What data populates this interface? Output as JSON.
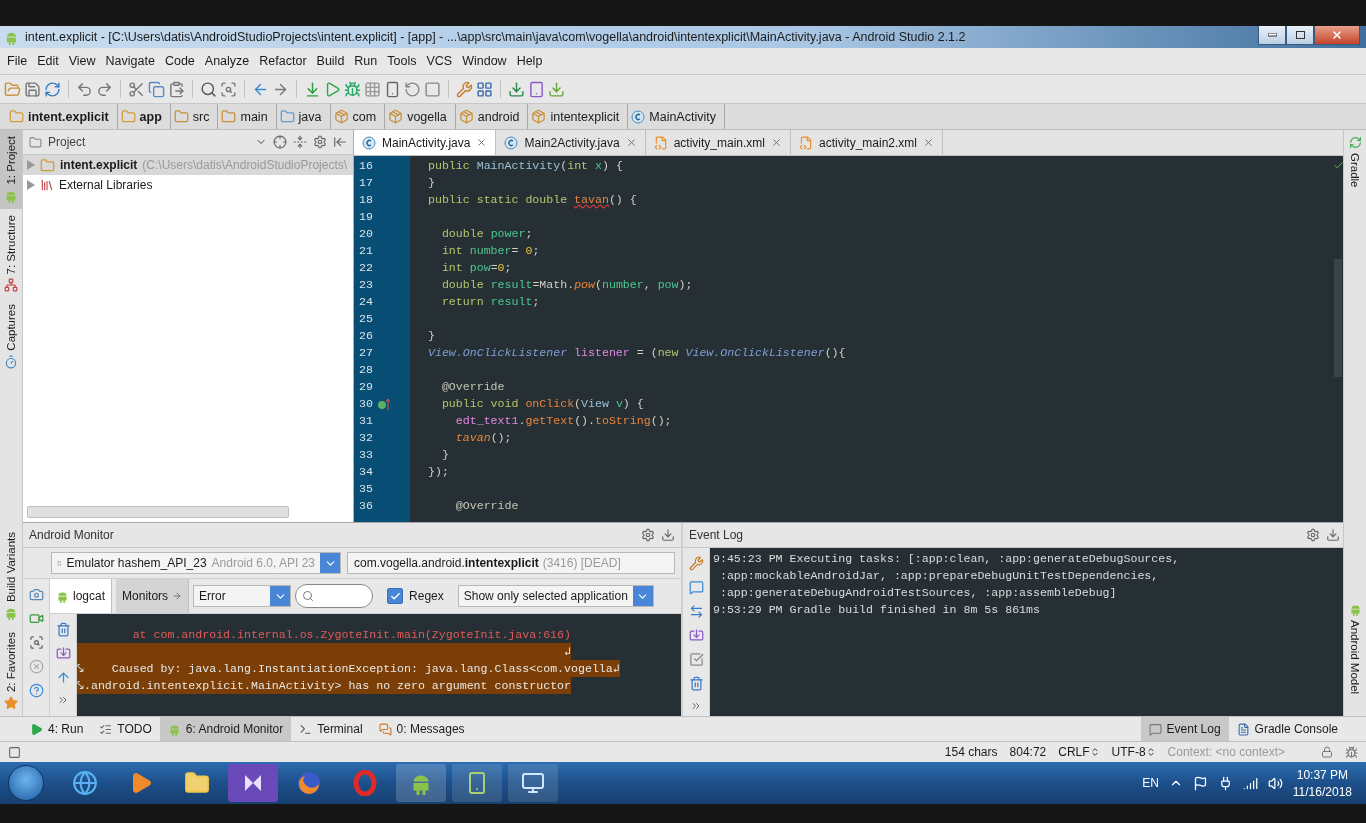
{
  "window": {
    "title": "intent.explicit - [C:\\Users\\datis\\AndroidStudioProjects\\intent.explicit] - [app] - ...\\app\\src\\main\\java\\com\\vogella\\android\\intentexplicit\\MainActivity.java - Android Studio 2.1.2"
  },
  "menu": [
    "File",
    "Edit",
    "View",
    "Navigate",
    "Code",
    "Analyze",
    "Refactor",
    "Build",
    "Run",
    "Tools",
    "VCS",
    "Window",
    "Help"
  ],
  "breadcrumbs": [
    {
      "label": "intent.explicit",
      "kind": "module"
    },
    {
      "label": "app",
      "kind": "module"
    },
    {
      "label": "src",
      "kind": "folder"
    },
    {
      "label": "main",
      "kind": "folder"
    },
    {
      "label": "java",
      "kind": "source"
    },
    {
      "label": "com",
      "kind": "package"
    },
    {
      "label": "vogella",
      "kind": "package"
    },
    {
      "label": "android",
      "kind": "package"
    },
    {
      "label": "intentexplicit",
      "kind": "package"
    },
    {
      "label": "MainActivity",
      "kind": "class"
    }
  ],
  "left_stripe": {
    "top": [
      {
        "label": "1: Project",
        "selected": true
      },
      {
        "label": "7: Structure",
        "selected": false
      },
      {
        "label": "Captures",
        "selected": false
      }
    ],
    "bottom": [
      {
        "label": "Build Variants",
        "selected": false
      },
      {
        "label": "2: Favorites",
        "selected": false
      }
    ]
  },
  "right_stripe": {
    "top": [
      "Gradle"
    ],
    "bottom": [
      "Android Model"
    ]
  },
  "project": {
    "view": "Project",
    "tree": [
      {
        "label": "intent.explicit",
        "detail": "(C:\\Users\\datis\\AndroidStudioProjects\\",
        "kind": "module",
        "selected": true
      },
      {
        "label": "External Libraries",
        "kind": "library",
        "selected": false
      }
    ]
  },
  "editor": {
    "tabs": [
      {
        "label": "MainActivity.java",
        "kind": "class",
        "selected": true
      },
      {
        "label": "Main2Activity.java",
        "kind": "class",
        "selected": false
      },
      {
        "label": "activity_main.xml",
        "kind": "xml",
        "selected": false
      },
      {
        "label": "activity_main2.xml",
        "kind": "xml",
        "selected": false
      }
    ],
    "lines": [
      {
        "number": "16",
        "marker": false,
        "tokens": [
          {
            "text": "public ",
            "kind": "kw"
          },
          {
            "text": "MainActivity",
            "kind": "type"
          },
          {
            "text": "(",
            "kind": "plain"
          },
          {
            "text": "int ",
            "kind": "kw"
          },
          {
            "text": "x",
            "kind": "field"
          },
          {
            "text": ") {",
            "kind": "plain"
          }
        ]
      },
      {
        "number": "17",
        "marker": false,
        "tokens": [
          {
            "text": "}",
            "kind": "plain"
          }
        ]
      },
      {
        "number": "18",
        "marker": false,
        "tokens": [
          {
            "text": "public static double ",
            "kind": "kw"
          },
          {
            "text": "tavan",
            "kind": "error"
          },
          {
            "text": "() {",
            "kind": "plain"
          }
        ]
      },
      {
        "number": "19",
        "marker": false
      },
      {
        "number": "20",
        "marker": false,
        "tokens": [
          {
            "text": "  double ",
            "kind": "kw"
          },
          {
            "text": "power",
            "kind": "field"
          },
          {
            "text": ";",
            "kind": "plain"
          }
        ]
      },
      {
        "number": "21",
        "marker": false,
        "tokens": [
          {
            "text": "  int ",
            "kind": "kw"
          },
          {
            "text": "number",
            "kind": "field"
          },
          {
            "text": "= ",
            "kind": "plain"
          },
          {
            "text": "0",
            "kind": "num"
          },
          {
            "text": ";",
            "kind": "plain"
          }
        ]
      },
      {
        "number": "22",
        "marker": false,
        "tokens": [
          {
            "text": "  int ",
            "kind": "kw"
          },
          {
            "text": "pow",
            "kind": "field"
          },
          {
            "text": "=",
            "kind": "plain"
          },
          {
            "text": "0",
            "kind": "num"
          },
          {
            "text": ";",
            "kind": "plain"
          }
        ]
      },
      {
        "number": "23",
        "marker": false,
        "tokens": [
          {
            "text": "  double ",
            "kind": "kw"
          },
          {
            "text": "result",
            "kind": "field"
          },
          {
            "text": "=Math.",
            "kind": "plain"
          },
          {
            "text": "pow",
            "kind": "static"
          },
          {
            "text": "(",
            "kind": "plain"
          },
          {
            "text": "number",
            "kind": "field"
          },
          {
            "text": ", ",
            "kind": "plain"
          },
          {
            "text": "pow",
            "kind": "field"
          },
          {
            "text": ");",
            "kind": "plain"
          }
        ]
      },
      {
        "number": "24",
        "marker": false,
        "tokens": [
          {
            "text": "  return ",
            "kind": "kw"
          },
          {
            "text": "result",
            "kind": "field"
          },
          {
            "text": ";",
            "kind": "plain"
          }
        ]
      },
      {
        "number": "25",
        "marker": false
      },
      {
        "number": "26",
        "marker": false,
        "tokens": [
          {
            "text": "}",
            "kind": "plain"
          }
        ]
      },
      {
        "number": "27",
        "marker": false,
        "tokens": [
          {
            "text": "View.OnClickListener",
            "kind": "itype"
          },
          {
            "text": " listener",
            "kind": "var"
          },
          {
            "text": " = (",
            "kind": "plain"
          },
          {
            "text": "new ",
            "kind": "kw"
          },
          {
            "text": "View.OnClickListener",
            "kind": "itype"
          },
          {
            "text": "(){",
            "kind": "plain"
          }
        ]
      },
      {
        "number": "28",
        "marker": false
      },
      {
        "number": "29",
        "marker": false,
        "tokens": [
          {
            "text": "  @Override",
            "kind": "annot"
          }
        ]
      },
      {
        "number": "30",
        "marker": true,
        "tokens": [
          {
            "text": "  public void ",
            "kind": "kw"
          },
          {
            "text": "onClick",
            "kind": "method"
          },
          {
            "text": "(",
            "kind": "plain"
          },
          {
            "text": "View",
            "kind": "type"
          },
          {
            "text": " v",
            "kind": "field"
          },
          {
            "text": ") {",
            "kind": "plain"
          }
        ]
      },
      {
        "number": "31",
        "marker": false,
        "tokens": [
          {
            "text": "    edt_text1",
            "kind": "var"
          },
          {
            "text": ".",
            "kind": "plain"
          },
          {
            "text": "getText",
            "kind": "method"
          },
          {
            "text": "().",
            "kind": "plain"
          },
          {
            "text": "toString",
            "kind": "method"
          },
          {
            "text": "();",
            "kind": "plain"
          }
        ]
      },
      {
        "number": "32",
        "marker": false,
        "tokens": [
          {
            "text": "    tavan",
            "kind": "static"
          },
          {
            "text": "();",
            "kind": "plain"
          }
        ]
      },
      {
        "number": "33",
        "marker": false,
        "tokens": [
          {
            "text": "  }",
            "kind": "plain"
          }
        ]
      },
      {
        "number": "34",
        "marker": false,
        "tokens": [
          {
            "text": "});",
            "kind": "plain"
          }
        ]
      },
      {
        "number": "35",
        "marker": false
      },
      {
        "number": "36",
        "marker": false,
        "tokens": [
          {
            "text": "    @Override",
            "kind": "annot"
          }
        ]
      }
    ]
  },
  "android_monitor": {
    "title": "Android Monitor",
    "device": "Emulator hashem_API_23",
    "device_detail": "Android 6.0, API 23",
    "process": "com.vogella.android.**intentexplicit**",
    "process_detail": "(3416) [DEAD]",
    "tabs": [
      {
        "label": "logcat",
        "selected": true
      },
      {
        "label": "Monitors",
        "selected": false
      }
    ],
    "log_level": "Error",
    "regex": {
      "label": "Regex",
      "checked": true
    },
    "filter": "Show only selected application",
    "log": [
      {
        "text": "        at com.android.internal.os.ZygoteInit.main(ZygoteInit.java:616)",
        "selected": false
      },
      {
        "text": "                                                                      ↲",
        "selected": true
      },
      {
        "text": "⤥    Caused by: java.lang.InstantiationException: java.lang.Class<com.vogella↲",
        "selected": true
      },
      {
        "text": "⤥.android.intentexplicit.MainActivity> has no zero argument constructor",
        "selected": true
      }
    ]
  },
  "event_log": {
    "title": "Event Log",
    "lines": [
      "9:45:23 PM Executing tasks: [:app:clean, :app:generateDebugSources,",
      " :app:mockableAndroidJar, :app:prepareDebugUnitTestDependencies,",
      " :app:generateDebugAndroidTestSources, :app:assembleDebug]",
      "9:53:29 PM Gradle build finished in 8m 5s 861ms"
    ]
  },
  "tool_windows": {
    "left": [
      {
        "label": "4: Run",
        "selected": false
      },
      {
        "label": "TODO",
        "selected": false
      },
      {
        "label": "6: Android Monitor",
        "selected": true
      },
      {
        "label": "Terminal",
        "selected": false
      },
      {
        "label": "0: Messages",
        "selected": false
      }
    ],
    "right": [
      {
        "label": "Event Log",
        "selected": true
      },
      {
        "label": "Gradle Console",
        "selected": false
      }
    ]
  },
  "status_bar": {
    "chars": "154 chars",
    "position": "804:72",
    "line_separator": "CRLF",
    "encoding": "UTF-8",
    "context": "Context: <no context>"
  },
  "taskbar": {
    "language": "EN",
    "time": "10:37 PM",
    "date": "11/16/2018"
  }
}
